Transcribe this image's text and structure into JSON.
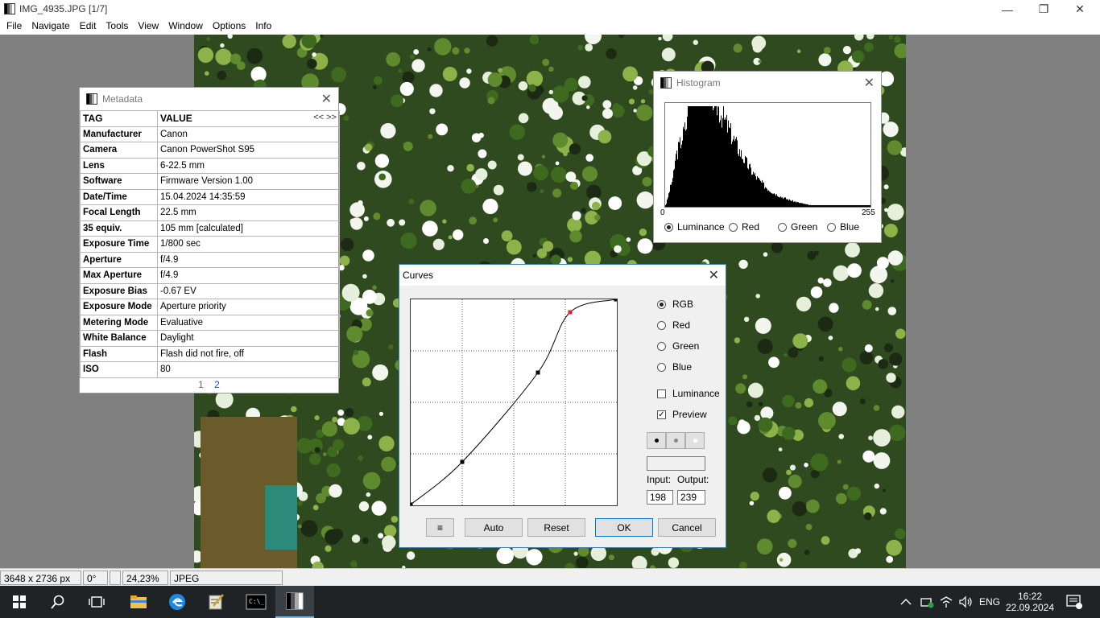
{
  "window": {
    "title": "IMG_4935.JPG  [1/7]"
  },
  "menu": [
    "File",
    "Navigate",
    "Edit",
    "Tools",
    "View",
    "Window",
    "Options",
    "Info"
  ],
  "metadata": {
    "title": "Metadata",
    "header_tag": "TAG",
    "header_value": "VALUE",
    "nav": "<< >>",
    "rows": [
      {
        "tag": "Manufacturer",
        "value": "Canon"
      },
      {
        "tag": "Camera",
        "value": "Canon PowerShot S95"
      },
      {
        "tag": "Lens",
        "value": "6-22.5 mm"
      },
      {
        "tag": "Software",
        "value": "Firmware Version 1.00"
      },
      {
        "tag": "Date/Time",
        "value": "15.04.2024 14:35:59"
      },
      {
        "tag": "Focal Length",
        "value": "22.5 mm"
      },
      {
        "tag": "35 equiv.",
        "value": "105 mm [calculated]"
      },
      {
        "tag": "Exposure Time",
        "value": "1/800 sec"
      },
      {
        "tag": "Aperture",
        "value": "f/4.9"
      },
      {
        "tag": "Max Aperture",
        "value": "f/4.9"
      },
      {
        "tag": "Exposure Bias",
        "value": "-0.67 EV"
      },
      {
        "tag": "Exposure Mode",
        "value": "Aperture priority"
      },
      {
        "tag": "Metering Mode",
        "value": "Evaluative"
      },
      {
        "tag": "White Balance",
        "value": "Daylight"
      },
      {
        "tag": "Flash",
        "value": "Flash did not fire, off"
      },
      {
        "tag": "ISO",
        "value": "80"
      }
    ],
    "pages": [
      "1",
      "2"
    ]
  },
  "histogram": {
    "title": "Histogram",
    "min_label": "0",
    "max_label": "255",
    "channels": [
      "Luminance",
      "Red",
      "Green",
      "Blue"
    ],
    "selected": "Luminance"
  },
  "curves": {
    "title": "Curves",
    "channels": [
      "RGB",
      "Red",
      "Green",
      "Blue"
    ],
    "selected_channel": "RGB",
    "luminance_label": "Luminance",
    "luminance_checked": false,
    "preview_label": "Preview",
    "preview_checked": true,
    "input_label": "Input:",
    "output_label": "Output:",
    "input_value": "198",
    "output_value": "239",
    "buttons": {
      "menu": "≡",
      "auto": "Auto",
      "reset": "Reset",
      "ok": "OK",
      "cancel": "Cancel"
    },
    "points": [
      [
        0,
        0
      ],
      [
        64,
        53
      ],
      [
        158,
        164
      ],
      [
        198,
        239
      ],
      [
        255,
        255
      ]
    ],
    "active_point": 3,
    "active_color": "#e02020"
  },
  "status": {
    "dimensions": "3648 x 2736 px",
    "rotation": "0°",
    "zoom": "24,23%",
    "format": "JPEG"
  },
  "taskbar": {
    "language": "ENG",
    "time": "16:22",
    "date": "22.09.2024"
  }
}
